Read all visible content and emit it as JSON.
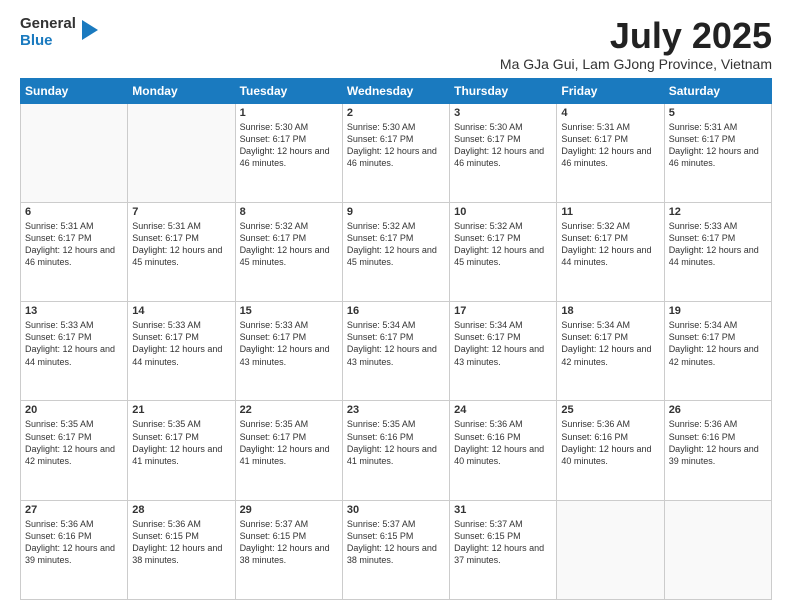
{
  "logo": {
    "general": "General",
    "blue": "Blue",
    "icon_color": "#1a7abf"
  },
  "header": {
    "month": "July 2025",
    "location": "Ma GJa Gui, Lam GJong Province, Vietnam"
  },
  "days_of_week": [
    "Sunday",
    "Monday",
    "Tuesday",
    "Wednesday",
    "Thursday",
    "Friday",
    "Saturday"
  ],
  "weeks": [
    [
      {
        "day": "",
        "info": ""
      },
      {
        "day": "",
        "info": ""
      },
      {
        "day": "1",
        "info": "Sunrise: 5:30 AM\nSunset: 6:17 PM\nDaylight: 12 hours and 46 minutes."
      },
      {
        "day": "2",
        "info": "Sunrise: 5:30 AM\nSunset: 6:17 PM\nDaylight: 12 hours and 46 minutes."
      },
      {
        "day": "3",
        "info": "Sunrise: 5:30 AM\nSunset: 6:17 PM\nDaylight: 12 hours and 46 minutes."
      },
      {
        "day": "4",
        "info": "Sunrise: 5:31 AM\nSunset: 6:17 PM\nDaylight: 12 hours and 46 minutes."
      },
      {
        "day": "5",
        "info": "Sunrise: 5:31 AM\nSunset: 6:17 PM\nDaylight: 12 hours and 46 minutes."
      }
    ],
    [
      {
        "day": "6",
        "info": "Sunrise: 5:31 AM\nSunset: 6:17 PM\nDaylight: 12 hours and 46 minutes."
      },
      {
        "day": "7",
        "info": "Sunrise: 5:31 AM\nSunset: 6:17 PM\nDaylight: 12 hours and 45 minutes."
      },
      {
        "day": "8",
        "info": "Sunrise: 5:32 AM\nSunset: 6:17 PM\nDaylight: 12 hours and 45 minutes."
      },
      {
        "day": "9",
        "info": "Sunrise: 5:32 AM\nSunset: 6:17 PM\nDaylight: 12 hours and 45 minutes."
      },
      {
        "day": "10",
        "info": "Sunrise: 5:32 AM\nSunset: 6:17 PM\nDaylight: 12 hours and 45 minutes."
      },
      {
        "day": "11",
        "info": "Sunrise: 5:32 AM\nSunset: 6:17 PM\nDaylight: 12 hours and 44 minutes."
      },
      {
        "day": "12",
        "info": "Sunrise: 5:33 AM\nSunset: 6:17 PM\nDaylight: 12 hours and 44 minutes."
      }
    ],
    [
      {
        "day": "13",
        "info": "Sunrise: 5:33 AM\nSunset: 6:17 PM\nDaylight: 12 hours and 44 minutes."
      },
      {
        "day": "14",
        "info": "Sunrise: 5:33 AM\nSunset: 6:17 PM\nDaylight: 12 hours and 44 minutes."
      },
      {
        "day": "15",
        "info": "Sunrise: 5:33 AM\nSunset: 6:17 PM\nDaylight: 12 hours and 43 minutes."
      },
      {
        "day": "16",
        "info": "Sunrise: 5:34 AM\nSunset: 6:17 PM\nDaylight: 12 hours and 43 minutes."
      },
      {
        "day": "17",
        "info": "Sunrise: 5:34 AM\nSunset: 6:17 PM\nDaylight: 12 hours and 43 minutes."
      },
      {
        "day": "18",
        "info": "Sunrise: 5:34 AM\nSunset: 6:17 PM\nDaylight: 12 hours and 42 minutes."
      },
      {
        "day": "19",
        "info": "Sunrise: 5:34 AM\nSunset: 6:17 PM\nDaylight: 12 hours and 42 minutes."
      }
    ],
    [
      {
        "day": "20",
        "info": "Sunrise: 5:35 AM\nSunset: 6:17 PM\nDaylight: 12 hours and 42 minutes."
      },
      {
        "day": "21",
        "info": "Sunrise: 5:35 AM\nSunset: 6:17 PM\nDaylight: 12 hours and 41 minutes."
      },
      {
        "day": "22",
        "info": "Sunrise: 5:35 AM\nSunset: 6:17 PM\nDaylight: 12 hours and 41 minutes."
      },
      {
        "day": "23",
        "info": "Sunrise: 5:35 AM\nSunset: 6:16 PM\nDaylight: 12 hours and 41 minutes."
      },
      {
        "day": "24",
        "info": "Sunrise: 5:36 AM\nSunset: 6:16 PM\nDaylight: 12 hours and 40 minutes."
      },
      {
        "day": "25",
        "info": "Sunrise: 5:36 AM\nSunset: 6:16 PM\nDaylight: 12 hours and 40 minutes."
      },
      {
        "day": "26",
        "info": "Sunrise: 5:36 AM\nSunset: 6:16 PM\nDaylight: 12 hours and 39 minutes."
      }
    ],
    [
      {
        "day": "27",
        "info": "Sunrise: 5:36 AM\nSunset: 6:16 PM\nDaylight: 12 hours and 39 minutes."
      },
      {
        "day": "28",
        "info": "Sunrise: 5:36 AM\nSunset: 6:15 PM\nDaylight: 12 hours and 38 minutes."
      },
      {
        "day": "29",
        "info": "Sunrise: 5:37 AM\nSunset: 6:15 PM\nDaylight: 12 hours and 38 minutes."
      },
      {
        "day": "30",
        "info": "Sunrise: 5:37 AM\nSunset: 6:15 PM\nDaylight: 12 hours and 38 minutes."
      },
      {
        "day": "31",
        "info": "Sunrise: 5:37 AM\nSunset: 6:15 PM\nDaylight: 12 hours and 37 minutes."
      },
      {
        "day": "",
        "info": ""
      },
      {
        "day": "",
        "info": ""
      }
    ]
  ]
}
